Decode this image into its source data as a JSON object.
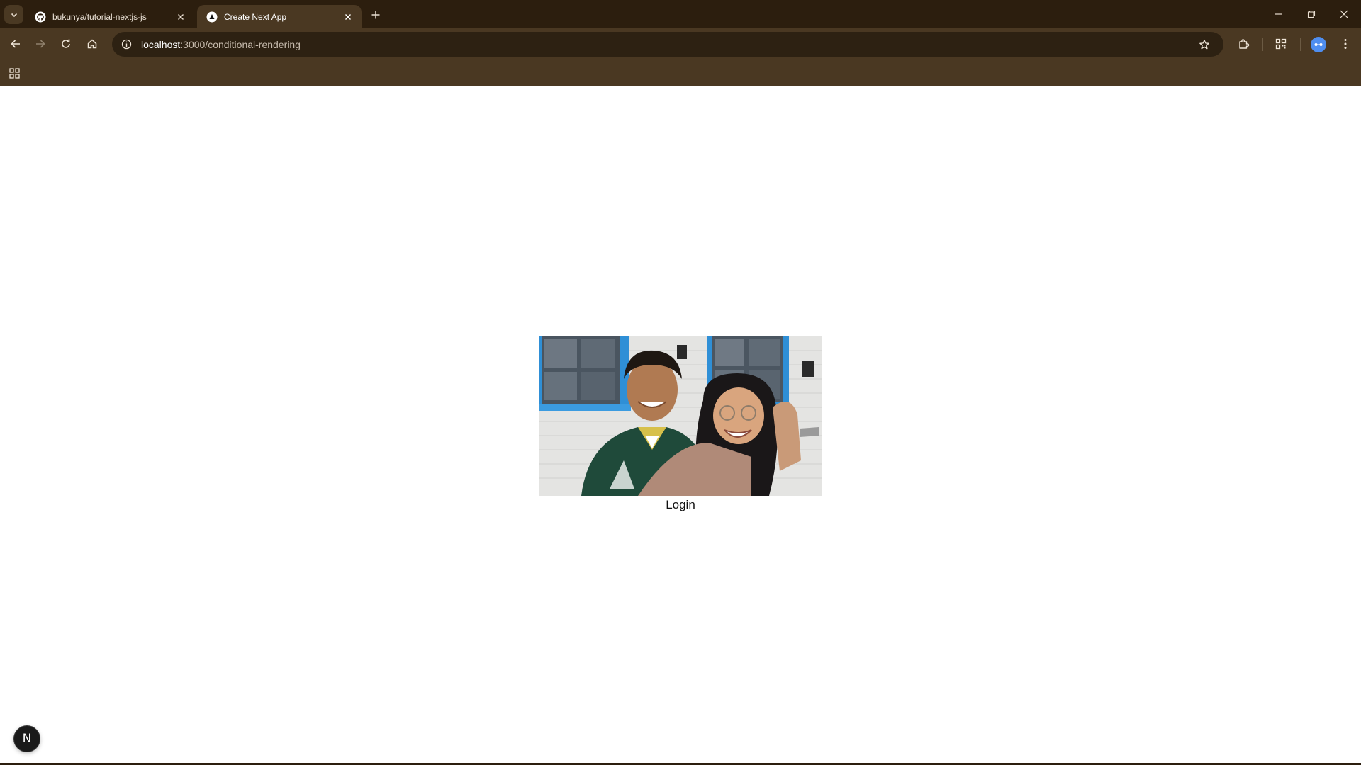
{
  "browser": {
    "tabs": [
      {
        "title": "bukunya/tutorial-nextjs-js",
        "favicon": "github-icon",
        "active": false
      },
      {
        "title": "Create Next App",
        "favicon": "nextjs-triangle-icon",
        "active": true
      }
    ],
    "address_bar": {
      "host": "localhost",
      "path": ":3000/conditional-rendering"
    },
    "toolbar_icons": [
      "back-arrow-icon",
      "forward-arrow-icon",
      "reload-icon",
      "home-icon",
      "site-info-icon",
      "bookmark-star-icon",
      "extensions-icon",
      "qr-code-icon",
      "profile-avatar-icon",
      "kebab-menu-icon"
    ],
    "window_controls": [
      "minimize-icon",
      "restore-icon",
      "close-icon"
    ]
  },
  "page": {
    "login_label": "Login",
    "image_subject": "photo-of-two-people-smiling",
    "next_badge_letter": "N"
  },
  "colors": {
    "tabstrip": "#2c1e0e",
    "toolbar": "#4a3822",
    "omnibox": "#2d2112",
    "page_background": "#ffffff",
    "avatar": "#4f8ef0"
  }
}
